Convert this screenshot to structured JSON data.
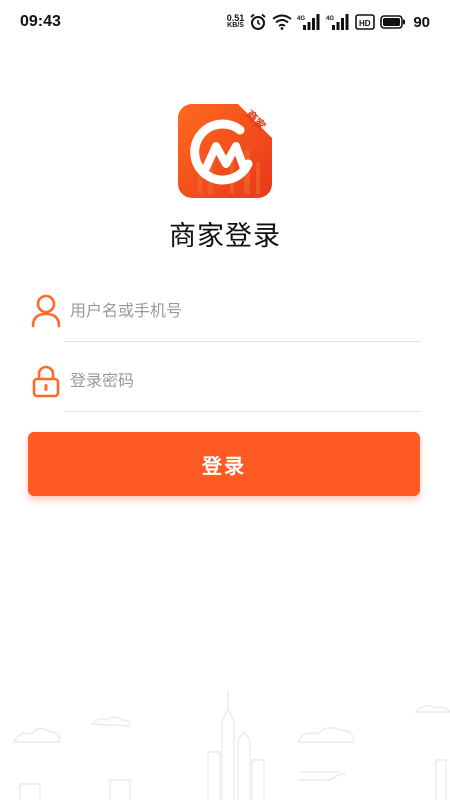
{
  "status_bar": {
    "time": "09:43",
    "net_speed_value": "0.51",
    "net_speed_unit": "KB/S",
    "signal_1": "4G",
    "signal_2": "4G",
    "hd_badge": "HD",
    "battery_level": "90",
    "icons": [
      "alarm-icon",
      "wifi-icon",
      "cellular-signal-icon",
      "cellular-signal-icon",
      "hd-voice-icon",
      "battery-icon"
    ]
  },
  "app": {
    "logo_badge": "商家",
    "title": "商家登录"
  },
  "form": {
    "username": {
      "placeholder": "用户名或手机号",
      "value": "",
      "icon": "user-icon"
    },
    "password": {
      "placeholder": "登录密码",
      "value": "",
      "icon": "lock-icon"
    },
    "submit_label": "登录"
  },
  "colors": {
    "accent": "#ff5a24",
    "accent_light": "#ff8a3d",
    "placeholder": "#9a9a9a",
    "divider": "#e3e3e3"
  }
}
